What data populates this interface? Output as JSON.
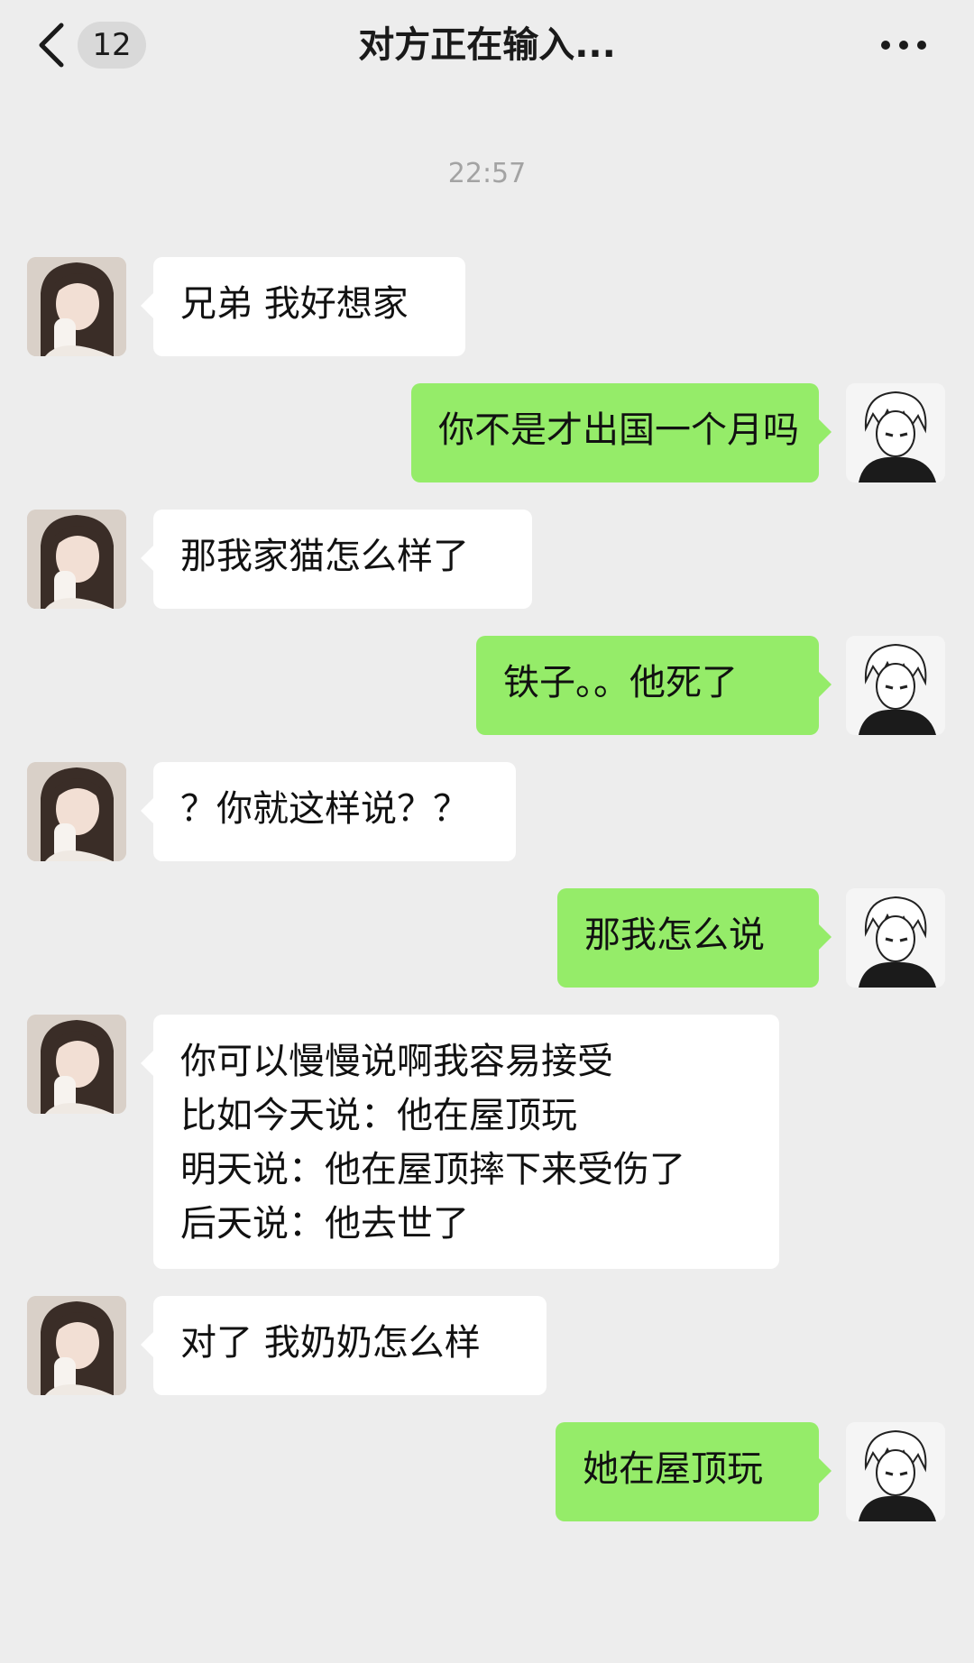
{
  "header": {
    "unread_count": "12",
    "title": "对方正在输入..."
  },
  "timestamp": "22:57",
  "messages": [
    {
      "side": "in",
      "text": "兄弟 我好想家"
    },
    {
      "side": "out",
      "text": "你不是才出国一个月吗"
    },
    {
      "side": "in",
      "text": "那我家猫怎么样了"
    },
    {
      "side": "out",
      "text": "铁子。。他死了"
    },
    {
      "side": "in",
      "text": "？你就这样说？？"
    },
    {
      "side": "out",
      "text": "那我怎么说"
    },
    {
      "side": "in",
      "text": "你可以慢慢说啊我容易接受\n比如今天说：他在屋顶玩\n明天说：他在屋顶摔下来受伤了\n后天说：他去世了"
    },
    {
      "side": "in",
      "text": "对了 我奶奶怎么样"
    },
    {
      "side": "out",
      "text": "她在屋顶玩"
    }
  ],
  "colors": {
    "background": "#ededed",
    "incoming_bubble": "#ffffff",
    "outgoing_bubble": "#95ec69",
    "timestamp_text": "#a3a3a3"
  },
  "icons": {
    "back": "chevron-left-icon",
    "more": "more-dots-icon"
  }
}
